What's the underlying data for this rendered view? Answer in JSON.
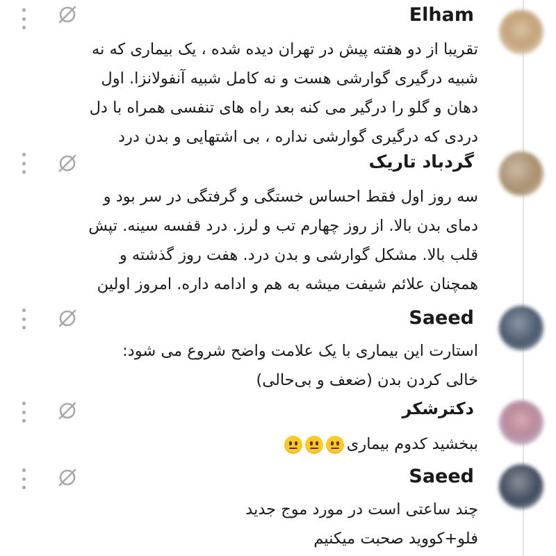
{
  "comments": [
    {
      "author": "Elham",
      "lines": [
        "تقریبا از دو هفته پیش  در تهران دیده شده ، یک بیماری که نه",
        "شبیه درگیری گوارشی هست و نه کامل شبیه آنفولانزا. اول",
        "دهان و گلو را درگیر می کنه بعد راه های تنفسی همراه با دل",
        "دردی که درگیری گوارشی نداره ، بی اشتهایی و بدن درد"
      ]
    },
    {
      "author": "گردباد تاریک",
      "lines": [
        "سه روز اول فقط احساس خستگی و گرفتگی در سر  بود و",
        "دمای بدن بالا. از روز چهارم تب و لرز. درد قفسه سینه. تپش",
        "قلب بالا. مشکل گوارشی و بدن درد. هفت روز گذشته و",
        "همچنان علائم شیفت میشه به هم و ادامه داره. امروز اولین"
      ]
    },
    {
      "author": "Saeed",
      "lines": [
        "استارت این بیماری با یک علامت واضح شروع می شود:",
        "خالی کردن بدن (ضعف و بی‌حالی)"
      ]
    },
    {
      "author": "دکترشکر",
      "lines": [
        "ببخشید کدوم بیماری"
      ],
      "emoji_count": 3
    },
    {
      "author": "Saeed",
      "lines": [
        "چند ساعتی است در مورد موج جدید",
        "فلو+کووید صحبت میکنیم"
      ]
    }
  ],
  "icons": {
    "more": "more-vertical-icon",
    "moderation": "no-entry-icon",
    "reaction": "neutral-face-emoji"
  },
  "colors": {
    "background": "#ffffff",
    "text": "#1a1a1a",
    "icon_gray": "#a8a8a8",
    "thread_line": "#e3e3e3"
  }
}
